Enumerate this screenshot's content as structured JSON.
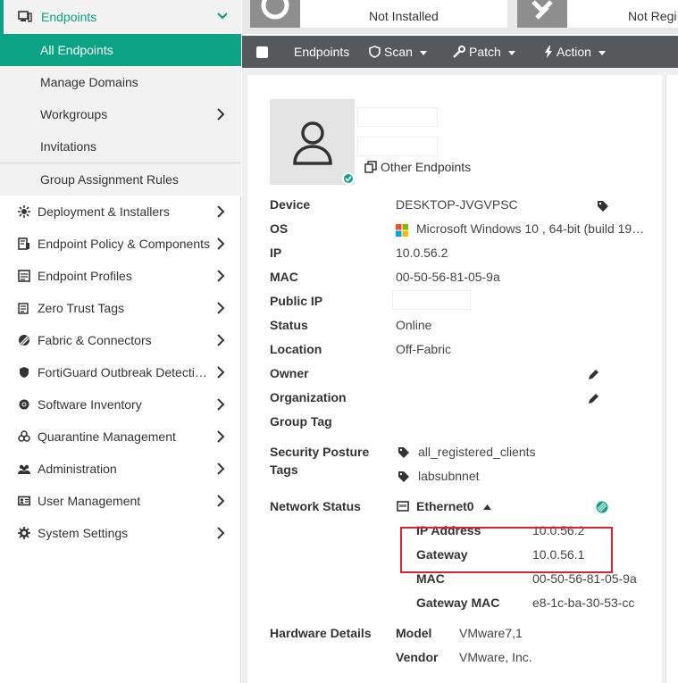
{
  "sidebar": {
    "header": {
      "label": "Endpoints",
      "icon": "endpoints-icon"
    },
    "subitems": [
      {
        "label": "All Endpoints",
        "active": true
      },
      {
        "label": "Manage Domains"
      },
      {
        "label": "Workgroups",
        "has_children": true
      },
      {
        "label": "Invitations"
      },
      {
        "label": "Group Assignment Rules"
      }
    ],
    "items": [
      {
        "label": "Deployment & Installers",
        "icon": "deployment-icon"
      },
      {
        "label": "Endpoint Policy & Components",
        "icon": "policy-icon"
      },
      {
        "label": "Endpoint Profiles",
        "icon": "profiles-icon"
      },
      {
        "label": "Zero Trust Tags",
        "icon": "tags-icon"
      },
      {
        "label": "Fabric & Connectors",
        "icon": "fabric-icon"
      },
      {
        "label": "FortiGuard Outbreak Detecti…",
        "icon": "outbreak-icon"
      },
      {
        "label": "Software Inventory",
        "icon": "software-icon"
      },
      {
        "label": "Quarantine Management",
        "icon": "biohazard-icon"
      },
      {
        "label": "Administration",
        "icon": "users-icon"
      },
      {
        "label": "User Management",
        "icon": "id-card-icon"
      },
      {
        "label": "System Settings",
        "icon": "gear-icon"
      }
    ]
  },
  "topcards": [
    {
      "text": "Not Installed",
      "icon": "status-circle-icon"
    },
    {
      "text": "Not Regi",
      "icon": "unregistered-icon"
    }
  ],
  "toolbar": {
    "endpoints": "Endpoints",
    "scan": "Scan",
    "patch": "Patch",
    "action": "Action"
  },
  "detail": {
    "other_endpoints": "Other Endpoints",
    "labels": {
      "device": "Device",
      "os": "OS",
      "ip": "IP",
      "mac": "MAC",
      "public_ip": "Public IP",
      "status": "Status",
      "location": "Location",
      "owner": "Owner",
      "organization": "Organization",
      "group_tag": "Group Tag",
      "security_posture_1": "Security Posture",
      "security_posture_2": "Tags",
      "network_status": "Network Status",
      "hardware_details": "Hardware Details"
    },
    "values": {
      "device": "DESKTOP-JVGVPSC",
      "os": "Microsoft Windows 10 , 64-bit (build 19…",
      "ip": "10.0.56.2",
      "mac": "00-50-56-81-05-9a",
      "public_ip": "",
      "status": "Online",
      "location": "Off-Fabric"
    },
    "tags": [
      "all_registered_clients",
      "labsubnnet"
    ],
    "network": {
      "interface": "Ethernet0",
      "rows": [
        {
          "label": "IP Address",
          "value": "10.0.56.2"
        },
        {
          "label": "Gateway",
          "value": "10.0.56.1"
        },
        {
          "label": "MAC",
          "value": "00-50-56-81-05-9a"
        },
        {
          "label": "Gateway MAC",
          "value": "e8-1c-ba-30-53-cc"
        }
      ]
    },
    "hardware": [
      {
        "label": "Model",
        "value": "VMware7,1"
      },
      {
        "label": "Vendor",
        "value": "VMware, Inc."
      }
    ]
  },
  "colors": {
    "accent": "#0ba383",
    "toolbar": "#55595c",
    "highlight_box": "#d9232e"
  }
}
